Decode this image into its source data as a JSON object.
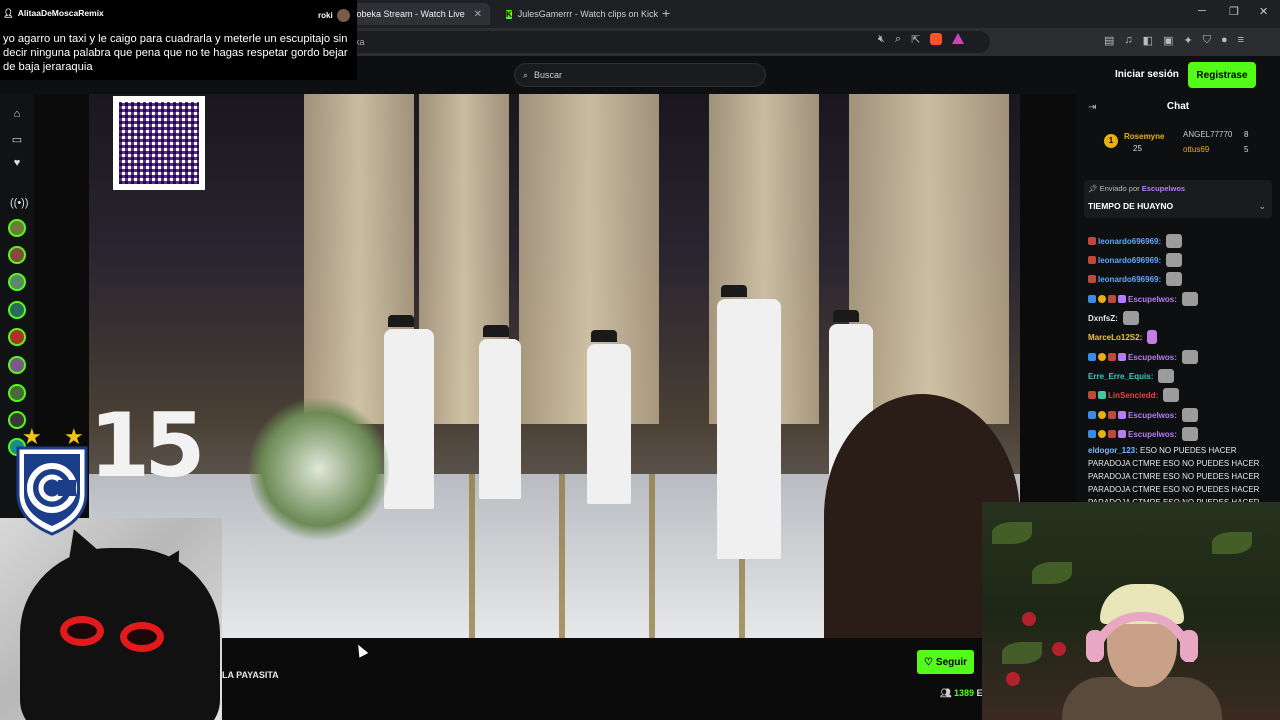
{
  "browser": {
    "tabs": [
      {
        "label": "iwobeka Stream - Watch Live"
      },
      {
        "label": "JulesGamerrr - Watch clips on Kick"
      }
    ],
    "url_visible": "eka"
  },
  "header": {
    "search_placeholder": "Buscar",
    "login_label": "Iniciar sesión",
    "signup_label": "Registrase"
  },
  "notification": {
    "author": "AlitaaDeMoscaRemix",
    "tag": "roki",
    "message": "yo agarro un taxi y le caigo para cuadrarla y meterle un escupitajo sin decir ninguna palabra que pena que no te hagas respetar gordo bejar de baja jeraraquia"
  },
  "video": {
    "qr_text": "yape",
    "cake_text": "15"
  },
  "below_video": {
    "stream_title": "LA PAYASITA",
    "follow_label": "Seguir",
    "viewers": "1389",
    "viewers_suffix": "E"
  },
  "chat": {
    "title": "Chat",
    "leaderboard": [
      {
        "rank": "1",
        "name": "Rosemyne",
        "count": "25"
      },
      {
        "name": "ANGEL77770",
        "count": "8"
      },
      {
        "name": "ottus69",
        "count": "5"
      }
    ],
    "pinned": {
      "sent_by_label": "Enviado por",
      "sent_by_user": "Escupelwos",
      "message": "TIEMPO DE HUAYNO"
    },
    "messages": [
      {
        "user": "leonardo696969:",
        "color": "#5fa8ff"
      },
      {
        "user": "leonardo696969:",
        "color": "#5fa8ff"
      },
      {
        "user": "leonardo696969:",
        "color": "#5fa8ff"
      },
      {
        "user": "Escupelwos:",
        "color": "#b67cf5"
      },
      {
        "user": "DxnfsZ:",
        "color": "#e8e8e8"
      },
      {
        "user": "MarceLo12S2:",
        "color": "#f3c246"
      },
      {
        "user": "Escupelwos:",
        "color": "#b67cf5"
      },
      {
        "user": "Erre_Erre_Equis:",
        "color": "#3fc9c0"
      },
      {
        "user": "LinSenciedd:",
        "color": "#e84545"
      },
      {
        "user": "Escupelwos:",
        "color": "#b67cf5"
      },
      {
        "user": "Escupelwos:",
        "color": "#b67cf5"
      }
    ],
    "spam_user": "eldogor_123:",
    "spam_lines": [
      "ESO NO PUEDES HACER",
      "PARADOJA CTMRE ESO NO PUEDES HACER",
      "PARADOJA CTMRE ESO NO PUEDES HACER",
      "PARADOJA CTMRE ESO NO PUEDES HACER",
      "PARADOJA CTMRE ESO NO PUEDES HACER"
    ]
  },
  "colors": {
    "kick_green": "#53fc18",
    "background": "#0b0b0c",
    "accent_purple": "#b67cf5"
  }
}
